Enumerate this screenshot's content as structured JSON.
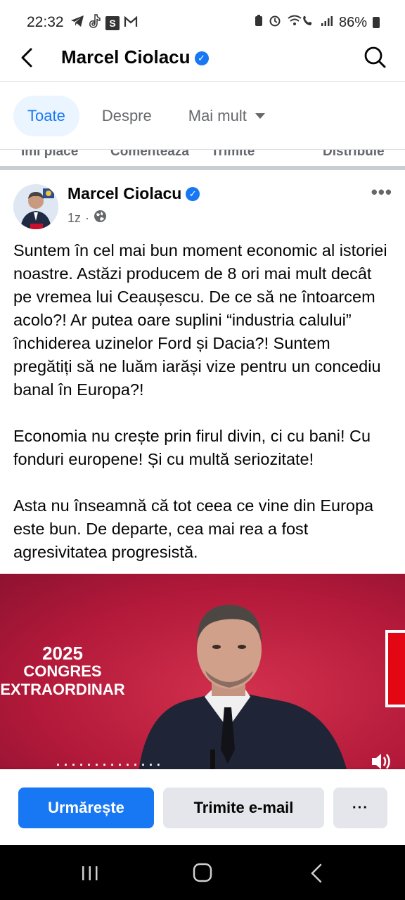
{
  "status_bar": {
    "time": "22:32",
    "battery": "86%",
    "left_icons": [
      "telegram-icon",
      "tiktok-icon",
      "s-app-icon",
      "gmail-icon"
    ],
    "right_icons": [
      "battery-saver-icon",
      "alarm-icon",
      "wifi-call-icon",
      "signal-icon",
      "battery-icon"
    ]
  },
  "header": {
    "title": "Marcel Ciolacu",
    "verified": true
  },
  "tabs": [
    {
      "label": "Toate",
      "active": true
    },
    {
      "label": "Despre",
      "active": false
    },
    {
      "label": "Mai mult",
      "active": false
    }
  ],
  "prev_post_actions": [
    "Îmi place",
    "Comentează",
    "Trimite",
    "Distribuie"
  ],
  "post": {
    "author": "Marcel Ciolacu",
    "time": "1z",
    "separator": "·",
    "paragraphs": [
      "Suntem în cel mai bun moment economic al istoriei noastre. Astăzi producem de 8 ori mai mult decât pe vremea lui Ceaușescu. De ce să ne întoarcem acolo?! Ar putea oare suplini “industria calului” închiderea uzinelor Ford și Dacia?! Suntem pregătiți să ne luăm iarăși vize pentru un concediu banal în Europa?!",
      "Economia nu crește prin firul divin, ci cu bani! Cu fonduri europene! Și cu multă seriozitate!",
      "Asta nu înseamnă că tot ceea ce vine din Europa este bun. De departe, cea mai rea a fost agresivitatea progresistă."
    ],
    "video": {
      "banner_year": "2025",
      "banner_line1": "CONGRES",
      "banner_line2": "EXTRAORDINAR"
    }
  },
  "actions": {
    "follow": "Urmărește",
    "email": "Trimite e-mail",
    "more": "···"
  },
  "colors": {
    "accent": "#1877f2",
    "tab_active_bg": "#ebf5ff",
    "video_bg": "#b81d3b"
  }
}
